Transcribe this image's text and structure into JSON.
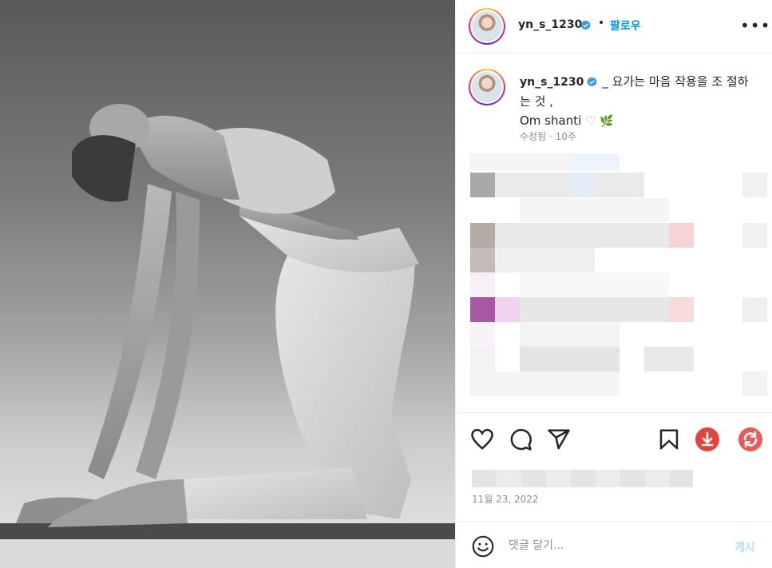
{
  "photo": {
    "alt_desc_icon": "yoga-photo"
  },
  "header": {
    "username": "yn_s_1230",
    "dot": "•",
    "follow_label": "팔로우",
    "more_label": "•••"
  },
  "caption": {
    "username": "yn_s_1230",
    "text_line": "_ 요가는 마음 작용을 조 절하는 것 ,",
    "text_line2": "Om shanti",
    "heart": "♡",
    "leaf": "🌿",
    "edited": "수정됨",
    "time_ago": "10주"
  },
  "actions": {
    "like_icon": "heart-icon",
    "comment_icon": "comment-icon",
    "share_icon": "share-icon",
    "save_icon": "bookmark-icon",
    "download_icon": "download-icon",
    "refresh_icon": "refresh-icon"
  },
  "date": "11월 23, 2022",
  "comment_bar": {
    "placeholder": "댓글 달기...",
    "post_label": "게시"
  },
  "colors": {
    "accent_blue": "#0095f6",
    "post_disabled": "#b2dffc",
    "download_red": "#e5443a",
    "verified_blue": "#3897f0"
  }
}
